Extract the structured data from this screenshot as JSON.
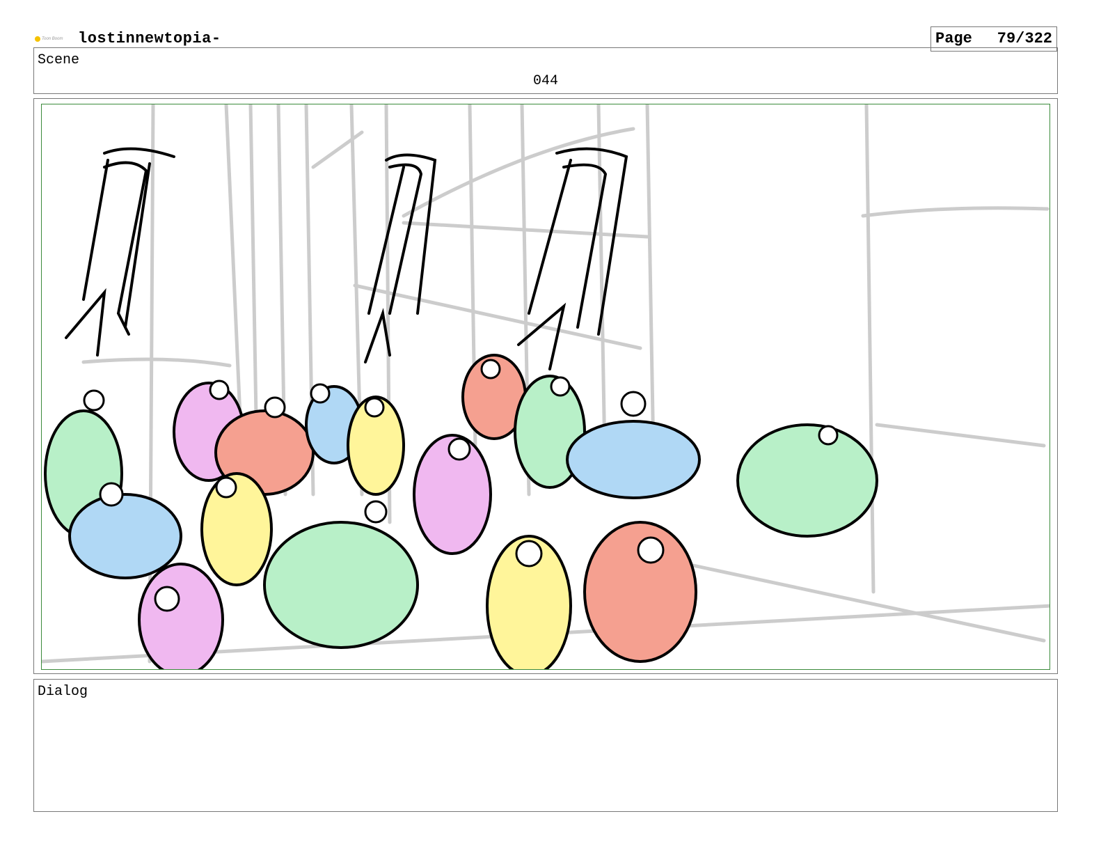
{
  "header": {
    "logo_text": "Toon Boom",
    "project_title": "lostinnewtopia-",
    "page_label": "Page",
    "page_value": "79/322"
  },
  "scene": {
    "label": "Scene",
    "number": "044"
  },
  "panel": {
    "colors": {
      "frame": "#3a8a3a",
      "green": "#b8f0c8",
      "pink": "#f0b8f0",
      "red": "#f5a090",
      "blue": "#b0d8f5",
      "yellow": "#fff59a",
      "sketch": "#cccccc"
    }
  },
  "dialog": {
    "label": "Dialog",
    "text": ""
  }
}
